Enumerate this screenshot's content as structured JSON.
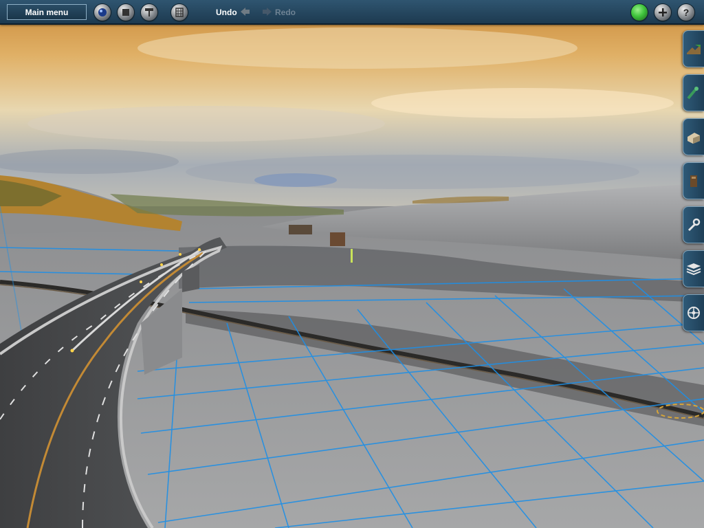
{
  "toolbar": {
    "main_menu_label": "Main menu",
    "undo_label": "Undo",
    "redo_label": "Redo"
  },
  "toolbar_icons": [
    "camera-icon",
    "stop-icon",
    "paint-roller-icon",
    "grid-icon",
    "green-status-icon",
    "plus-icon",
    "help-icon"
  ],
  "side_tabs": [
    "terrain-tool-icon",
    "track-tool-icon",
    "building-tool-icon",
    "object-tool-icon",
    "settings-wrench-icon",
    "layers-icon",
    "driver-wheel-icon"
  ],
  "colors": {
    "toolbar_bg": "#24465e",
    "grid_line": "#1e8fe6",
    "status_green": "#3ec43b"
  }
}
